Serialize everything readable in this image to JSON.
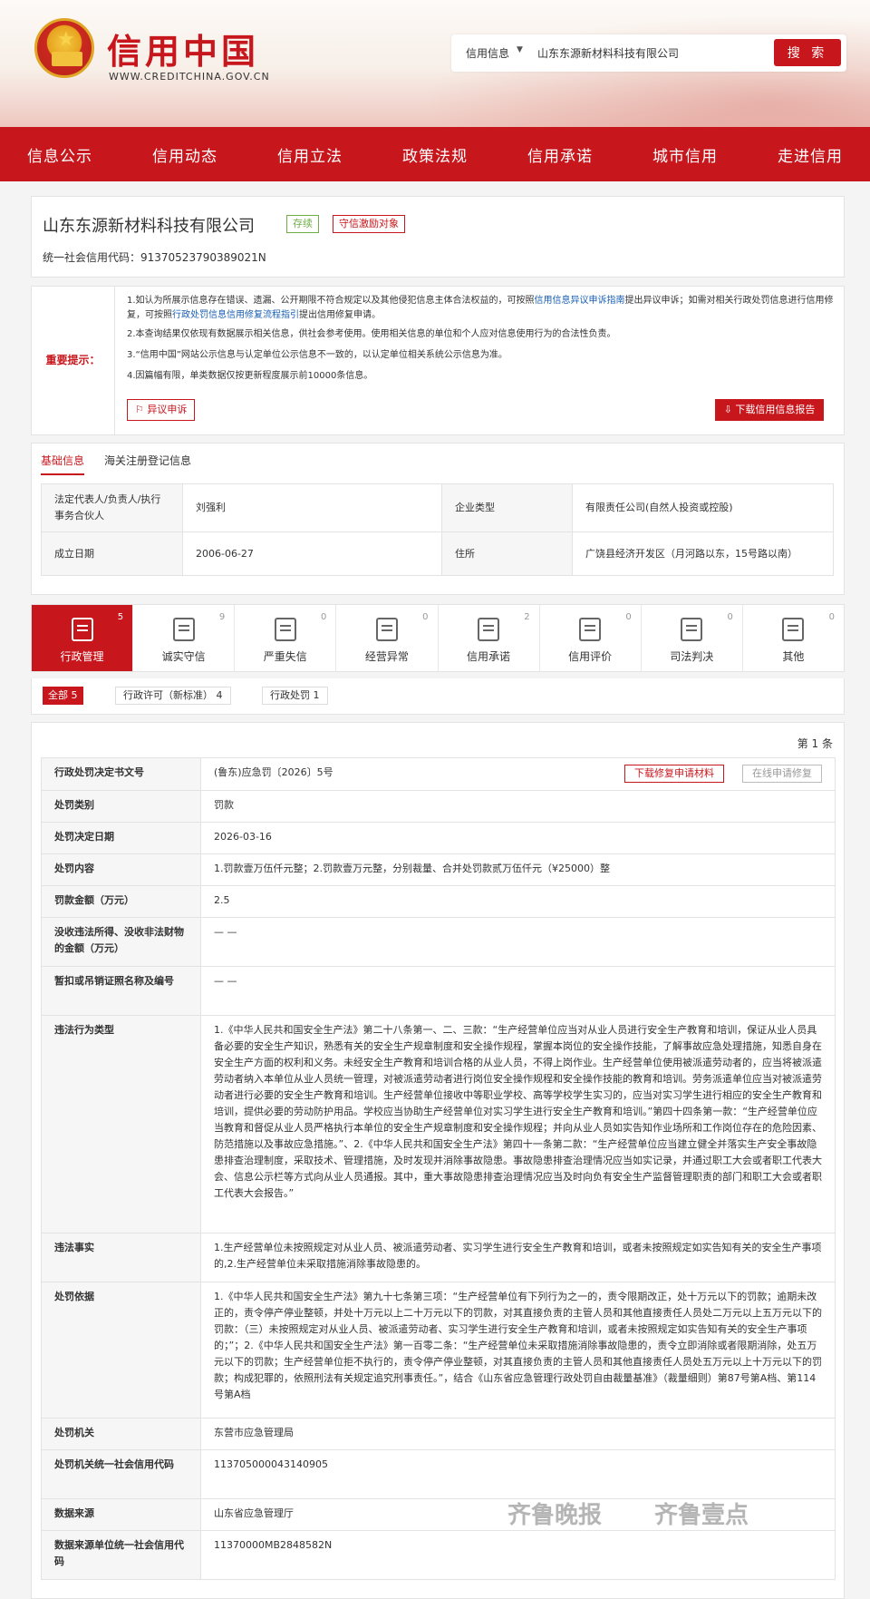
{
  "header": {
    "title": "信用中国",
    "url": "WWW.CREDITCHINA.GOV.CN",
    "search_type": "信用信息",
    "search_value": "山东东源新材料科技有限公司",
    "search_button": "搜 索"
  },
  "nav": [
    "信息公示",
    "信用动态",
    "信用立法",
    "政策法规",
    "信用承诺",
    "城市信用",
    "走进信用"
  ],
  "company": {
    "name": "山东东源新材料科技有限公司",
    "tag_status": "存续",
    "tag_incentive": "守信激励对象",
    "credit_code": "统一社会信用代码：913705237903890​21N"
  },
  "notice": {
    "label": "重要提示：",
    "item1a": "1.如认为所展示信息存在错误、遗漏、公开期限不符合规定以及其他侵犯信息主体合法权益的，可按照",
    "item1_link1": "信用信息异议申诉指南",
    "item1b": "提出异议申诉；如需对相关行政处罚信息进行信用修复，可按照",
    "item1_link2": "行政处罚信息信用修复流程指引",
    "item1c": "提出信用修复申请。",
    "item2": "2.本查询结果仅依现有数据展示相关信息，供社会参考使用。使用相关信息的单位和个人应对信息使用行为的合法性负责。",
    "item3": "3.“信用中国”网站公示信息与认定单位公示信息不一致的，以认定单位相关系统公示信息为准。",
    "item4": "4.因篇幅有限，单类数据仅按更新程度展示前10000条信息。",
    "appeal_button": "异议申诉",
    "report_button": "下载信用信息报告"
  },
  "basic": {
    "tab1": "基础信息",
    "tab2": "海关注册登记信息",
    "rows": [
      {
        "k1": "法定代表人/负责人/执行事务合伙人",
        "v1": "刘强利",
        "k2": "企业类型",
        "v2": "有限责任公司(自然人投资或控股)"
      },
      {
        "k1": "成立日期",
        "v1": "2006-06-27",
        "k2": "住所",
        "v2": "广饶县经济开发区（月河路以东，15号路以南）"
      }
    ]
  },
  "categories": [
    {
      "label": "行政管理",
      "count": "5"
    },
    {
      "label": "诚实守信",
      "count": "9"
    },
    {
      "label": "严重失信",
      "count": "0"
    },
    {
      "label": "经营异常",
      "count": "0"
    },
    {
      "label": "信用承诺",
      "count": "2"
    },
    {
      "label": "信用评价",
      "count": "0"
    },
    {
      "label": "司法判决",
      "count": "0"
    },
    {
      "label": "其他",
      "count": "0"
    }
  ],
  "filters": {
    "all": "全部  5",
    "permit": "行政许可（新标准）  4",
    "penalty": "行政处罚  1"
  },
  "detail": {
    "record_count": "第 1 条",
    "download_button": "下载修复申请材料",
    "repair_button": "在线申请修复",
    "rows": [
      {
        "k": "行政处罚决定书文号",
        "v": "(鲁东)应急罚〔2026〕5号"
      },
      {
        "k": "处罚类别",
        "v": "罚款"
      },
      {
        "k": "处罚决定日期",
        "v": "2026-03-16"
      },
      {
        "k": "处罚内容",
        "v": "1.罚款壹万伍仟元整；2.罚款壹万元整，分别裁量、合并处罚款贰万伍仟元（¥25000）整"
      },
      {
        "k": "罚款金额（万元）",
        "v": "2.5"
      },
      {
        "k": "没收违法所得、没收非法财物的金额（万元）",
        "v": "— —"
      },
      {
        "k": "暂扣或吊销证照名称及编号",
        "v": "— —"
      },
      {
        "k": "违法行为类型",
        "v": "1.《中华人民共和国安全生产法》第二十八条第一、二、三款：“生产经营单位应当对从业人员进行安全生产教育和培训，保证从业人员具备必要的安全生产知识，熟悉有关的安全生产规章制度和安全操作规程，掌握本岗位的安全操作技能，了解事故应急处理措施，知悉自身在安全生产方面的权利和义务。未经安全生产教育和培训合格的从业人员，不得上岗作业。生产经营单位使用被派遣劳动者的，应当将被派遣劳动者纳入本单位从业人员统一管理，对被派遣劳动者进行岗位安全操作规程和安全操作技能的教育和培训。劳务派遣单位应当对被派遣劳动者进行必要的安全生产教育和培训。生产经营单位接收中等职业学校、高等学校学生实习的，应当对实习学生进行相应的安全生产教育和培训，提供必要的劳动防护用品。学校应当协助生产经营单位对实习学生进行安全生产教育和培训。”第四十四条第一款：“生产经营单位应当教育和督促从业人员严格执行本单位的安全生产规章制度和安全操作规程；并向从业人员如实告知作业场所和工作岗位存在的危险因素、防范措施以及事故应急措施。”、2.《中华人民共和国安全生产法》第四十一条第二款：“生产经营单位应当建立健全并落实生产安全事故隐患排查治理制度，采取技术、管理措施，及时发现并消除事故隐患。事故隐患排查治理情况应当如实记录，并通过职工大会或者职工代表大会、信息公示栏等方式向从业人员通报。其中，重大事故隐患排查治理情况应当及时向负有安全生产监督管理职责的部门和职工大会或者职工代表大会报告。”"
      },
      {
        "k": "违法事实",
        "v": "1.生产经营单位未按照规定对从业人员、被派遣劳动者、实习学生进行安全生产教育和培训，或者未按照规定如实告知有关的安全生产事项的,2.生产经营单位未采取措施消除事故隐患的。"
      },
      {
        "k": "处罚依据",
        "v": "1.《中华人民共和国安全生产法》第九十七条第三项：“生产经营单位有下列行为之一的，责令限期改正，处十万元以下的罚款；逾期未改正的，责令停产停业整顿，并处十万元以上二十万元以下的罚款，对其直接负责的主管人员和其他直接责任人员处二万元以上五万元以下的罚款：（三）未按照规定对从业人员、被派遣劳动者、实习学生进行安全生产教育和培训，或者未按照规定如实告知有关的安全生产事项的；”；2.《中华人民共和国安全生产法》第一百零二条：“生产经营单位未采取措施消除事故隐患的，责令立即消除或者限期消除，处五万元以下的罚款；生产经营单位拒不执行的，责令停产停业整顿，对其直接负责的主管人员和其他直接责任人员处五万元以上十万元以下的罚款；构成犯罪的，依照刑法有关规定追究刑事责任。”，结合《山东省应急管理行政处罚自由裁量基准》（裁量细则）第87号第A档、第114号第A档"
      },
      {
        "k": "处罚机关",
        "v": "东营市应急管理局"
      },
      {
        "k": "处罚机关统一社会信用代码",
        "v": "11370500004314​0905"
      },
      {
        "k": "数据来源",
        "v": "山东省应急管理厅"
      },
      {
        "k": "数据来源单位统一社会信用代码",
        "v": "11370000MB2848582N"
      }
    ]
  },
  "watermark": {
    "left": "齐鲁晚报",
    "right": "齐鲁壹点"
  }
}
